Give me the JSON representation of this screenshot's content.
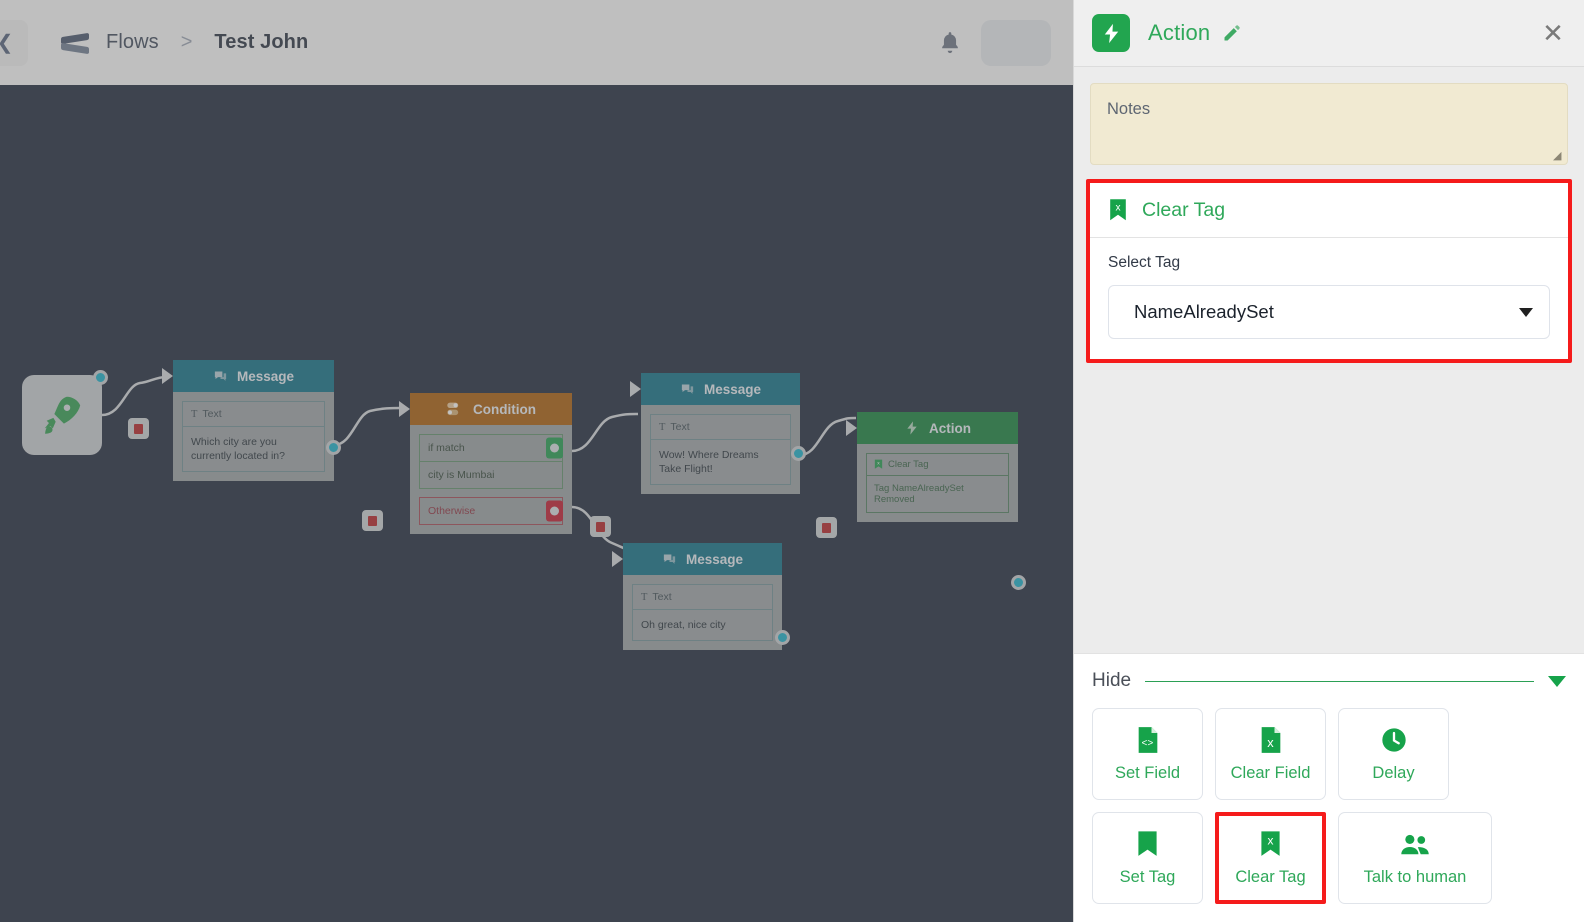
{
  "header": {
    "back_icon": "chevron-left-icon",
    "logo_icon": "flows-logo-icon",
    "breadcrumb_root": "Flows",
    "breadcrumb_separator": ">",
    "breadcrumb_current": "Test John",
    "bell_icon": "notification-bell-icon"
  },
  "canvas": {
    "start_icon": "rocket-icon",
    "nodes": [
      {
        "type": "message",
        "title": "Message",
        "icon": "message-icon",
        "field_label": "Text",
        "field_label_icon": "text-T-icon",
        "field_value": "Which city are you currently located in?"
      },
      {
        "type": "condition",
        "title": "Condition",
        "icon": "toggle-switch-icon",
        "if_label": "if match",
        "if_value": "city is Mumbai",
        "else_label": "Otherwise"
      },
      {
        "type": "message",
        "title": "Message",
        "icon": "message-icon",
        "field_label": "Text",
        "field_label_icon": "text-T-icon",
        "field_value": "Wow! Where Dreams Take Flight!"
      },
      {
        "type": "message",
        "title": "Message",
        "icon": "message-icon",
        "field_label": "Text",
        "field_label_icon": "text-T-icon",
        "field_value": "Oh great, nice city"
      },
      {
        "type": "action",
        "title": "Action",
        "icon": "lightning-bolt-icon",
        "act_label": "Clear Tag",
        "act_label_icon": "tag-clear-icon",
        "act_value": "Tag NameAlreadySet Removed"
      }
    ],
    "delete_icon": "trash-icon"
  },
  "panel": {
    "icon": "lightning-bolt-icon",
    "title": "Action",
    "edit_icon": "pencil-icon",
    "close_icon": "close-x-icon",
    "notes": {
      "placeholder": "Notes",
      "value": "",
      "resize_icon": "resize-grip-icon"
    },
    "clear_tag_card": {
      "icon": "tag-clear-icon",
      "title": "Clear Tag",
      "select_label": "Select Tag",
      "select_value": "NameAlreadySet",
      "caret_icon": "chevron-down-icon"
    },
    "footer": {
      "hide_label": "Hide",
      "hide_caret_icon": "chevron-down-icon",
      "tiles": [
        {
          "label": "Set Field",
          "icon": "file-code-icon"
        },
        {
          "label": "Clear Field",
          "icon": "file-x-icon"
        },
        {
          "label": "Delay",
          "icon": "clock-icon"
        },
        {
          "label": "Set Tag",
          "icon": "tag-icon"
        },
        {
          "label": "Clear Tag",
          "icon": "tag-clear-icon",
          "highlighted": true
        },
        {
          "label": "Talk to human",
          "icon": "people-icon"
        }
      ]
    }
  },
  "colors": {
    "accent_green": "#2fa85a",
    "highlight_red": "#f51b1b",
    "canvas_bg": "#1c2639",
    "panel_bg": "#ececec",
    "message_node": "#0d6e85",
    "condition_node": "#aa5c08",
    "action_node": "#13803a",
    "notes_bg": "#f1ead2"
  }
}
